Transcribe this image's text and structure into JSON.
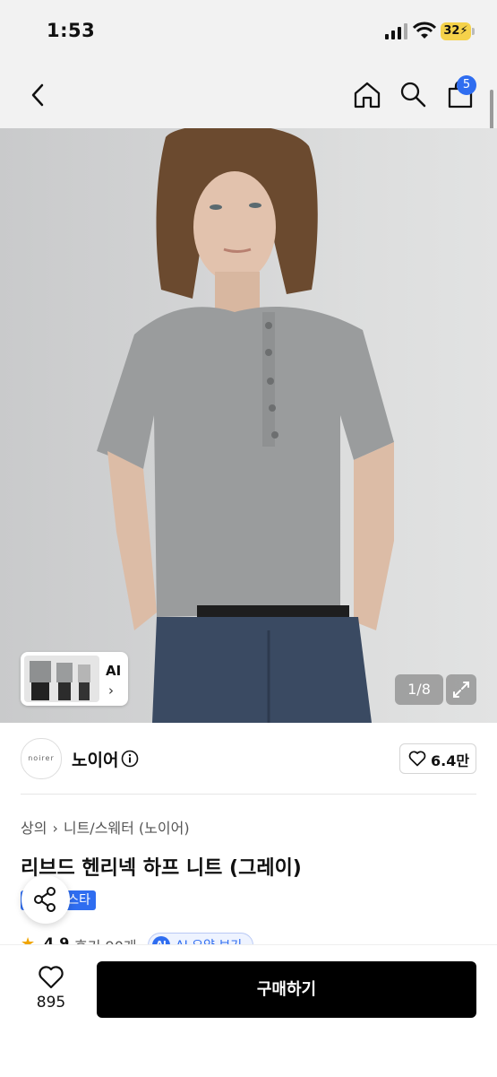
{
  "status_bar": {
    "time": "1:53",
    "battery": "32"
  },
  "nav": {
    "cart_count": "5"
  },
  "hero": {
    "image_counter": "1/8",
    "ai_label": "AI"
  },
  "brand": {
    "logo_text": "noirer",
    "name": "노이어",
    "likes": "6.4만"
  },
  "breadcrumb": {
    "category": "상의",
    "subcategory": "니트/스웨터 (노이어)"
  },
  "product": {
    "title": "리브드 헨리넥 하프 니트 (그레이)",
    "tag": "스타"
  },
  "rating": {
    "score": "4.9",
    "reviews": "후기 90개",
    "ai_summary": "AI 요약 보기"
  },
  "bottom_bar": {
    "wish_count": "895",
    "buy_label": "구매하기"
  },
  "colors": {
    "accent": "#2f6df0",
    "buy_button": "#000000",
    "star": "#f0a500"
  }
}
